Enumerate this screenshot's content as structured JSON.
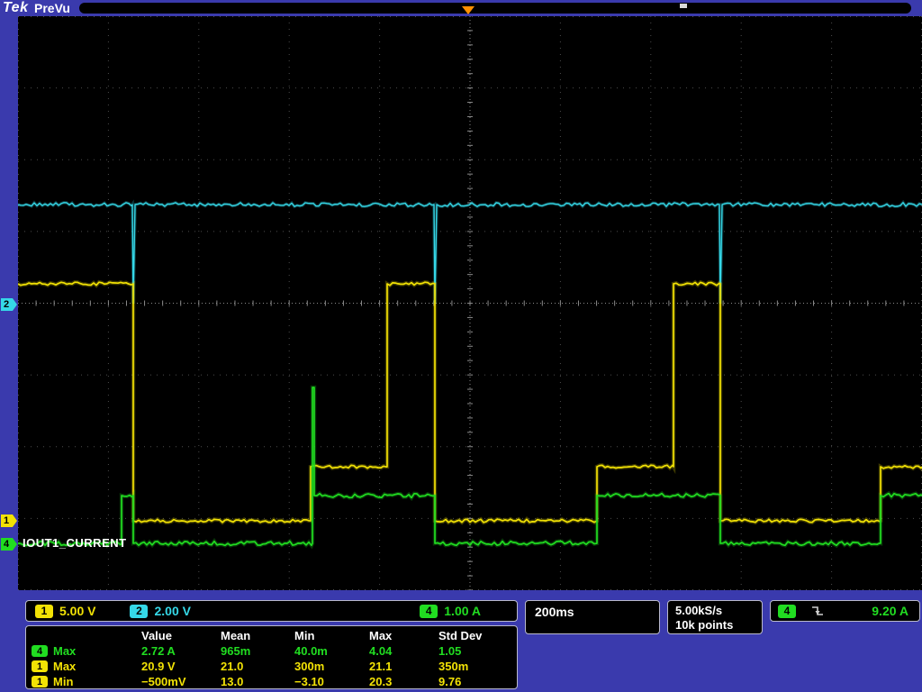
{
  "header": {
    "brand": "Tek",
    "mode": "PreVu"
  },
  "graticule": {
    "annotation": "IOUT1_CURRENT"
  },
  "markers": {
    "ch1": "1",
    "ch2": "2",
    "ch4": "4"
  },
  "colors": {
    "ch1": "#f2e205",
    "ch2": "#35d8e8",
    "ch4": "#21dd21",
    "trigger": "#ff9000",
    "background": "#3a3aad"
  },
  "readouts": {
    "channels": [
      {
        "badge": "1",
        "scale": "5.00 V"
      },
      {
        "badge": "2",
        "scale": "2.00 V"
      },
      {
        "badge": "4",
        "scale": "1.00 A"
      }
    ],
    "timebase": "200ms",
    "sample_rate": "5.00kS/s",
    "record_length": "10k points",
    "trigger": {
      "badge": "4",
      "level": "9.20 A"
    }
  },
  "measurements": {
    "headers": [
      "Value",
      "Mean",
      "Min",
      "Max",
      "Std Dev"
    ],
    "rows": [
      {
        "badge": "4",
        "label": "Max",
        "values": [
          "2.72 A",
          "965m",
          "40.0m",
          "4.04",
          "1.05"
        ]
      },
      {
        "badge": "1",
        "label": "Max",
        "values": [
          "20.9 V",
          "21.0",
          "300m",
          "21.1",
          "350m"
        ]
      },
      {
        "badge": "1",
        "label": "Min",
        "values": [
          "−500mV",
          "13.0",
          "−3.10",
          "20.3",
          "9.76"
        ]
      }
    ]
  },
  "chart_data": {
    "type": "line",
    "title": "Oscilloscope PreVu traces",
    "x_units": "200 ms/div, 10 divisions",
    "grid": {
      "cols": 10,
      "rows": 8
    },
    "series": [
      {
        "name": "ch2-trace",
        "color": "#35d8e8",
        "width": 1.4,
        "noise": 2.2,
        "points": [
          [
            0,
            209
          ],
          [
            127,
            209
          ],
          [
            128,
            319
          ],
          [
            130,
            209
          ],
          [
            462,
            209
          ],
          [
            463,
            319
          ],
          [
            465,
            209
          ],
          [
            779,
            209
          ],
          [
            780,
            319
          ],
          [
            782,
            209
          ],
          [
            1004,
            209
          ]
        ]
      },
      {
        "name": "ch1-trace",
        "color": "#f2e205",
        "width": 1.7,
        "noise": 1.8,
        "points": [
          [
            0,
            297
          ],
          [
            128,
            297
          ],
          [
            128,
            560
          ],
          [
            325,
            560
          ],
          [
            325,
            500
          ],
          [
            410,
            500
          ],
          [
            410,
            297
          ],
          [
            463,
            297
          ],
          [
            463,
            560
          ],
          [
            643,
            560
          ],
          [
            643,
            500
          ],
          [
            728,
            500
          ],
          [
            728,
            297
          ],
          [
            780,
            297
          ],
          [
            780,
            560
          ],
          [
            958,
            560
          ],
          [
            958,
            500
          ],
          [
            1004,
            500
          ]
        ]
      },
      {
        "name": "ch4-trace",
        "color": "#21dd21",
        "width": 1.7,
        "noise": 2.4,
        "points": [
          [
            0,
            585
          ],
          [
            115,
            585
          ],
          [
            115,
            532
          ],
          [
            128,
            532
          ],
          [
            128,
            585
          ],
          [
            327,
            585
          ],
          [
            327,
            412
          ],
          [
            329,
            412
          ],
          [
            329,
            532
          ],
          [
            463,
            532
          ],
          [
            463,
            585
          ],
          [
            643,
            585
          ],
          [
            643,
            532
          ],
          [
            780,
            532
          ],
          [
            780,
            585
          ],
          [
            958,
            585
          ],
          [
            958,
            532
          ],
          [
            1004,
            532
          ]
        ]
      }
    ]
  }
}
